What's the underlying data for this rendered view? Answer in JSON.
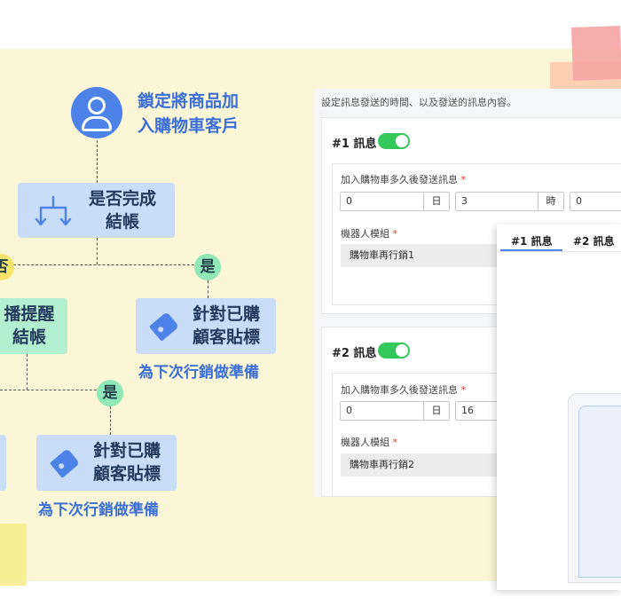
{
  "flow": {
    "start_label_line1": "鎖定將商品加",
    "start_label_line2": "入購物車客戶",
    "decision_line1": "是否完成",
    "decision_line2": "結帳",
    "no_badge": "否",
    "yes_badge": "是",
    "broadcast_line1": "播提醒",
    "broadcast_line2": "結帳",
    "tag_box_line1": "針對已購",
    "tag_box_line2": "顧客貼標",
    "tag_caption": "為下次行銷做準備",
    "yes_badge_2": "是",
    "tag_box2_line1": "針對已購",
    "tag_box2_line2": "顧客貼標",
    "tag_caption_2": "為下次行銷做準備"
  },
  "panel": {
    "description": "設定訊息發送的時間、以及發送的訊息內容。",
    "messages": [
      {
        "title": "#1 訊息",
        "enabled": true,
        "delay_label": "加入購物車多久後發送訊息",
        "required_mark": "*",
        "day_value": "0",
        "day_unit": "日",
        "hour_value": "3",
        "hour_unit": "時",
        "minute_value": "0",
        "module_label": "機器人模組",
        "module_value": "購物車再行銷1"
      },
      {
        "title": "#2 訊息",
        "enabled": true,
        "delay_label": "加入購物車多久後發送訊息",
        "required_mark": "*",
        "day_value": "0",
        "day_unit": "日",
        "hour_value": "16",
        "module_label": "機器人模組",
        "module_value": "購物車再行銷2"
      }
    ]
  },
  "overlay": {
    "tabs": [
      {
        "label": "#1 訊息",
        "active": true
      },
      {
        "label": "#2 訊息",
        "active": false
      }
    ]
  },
  "colors": {
    "accent_blue": "#4d82e8",
    "toggle_green": "#34c759",
    "badge_green": "#8fe8b5",
    "box_blue": "#c9dcf8",
    "box_green": "#b3f0cf",
    "background_yellow": "#fbf7d6"
  },
  "icons": {
    "avatar": "user-icon",
    "decision": "branch-icon",
    "tag": "tag-icon"
  }
}
